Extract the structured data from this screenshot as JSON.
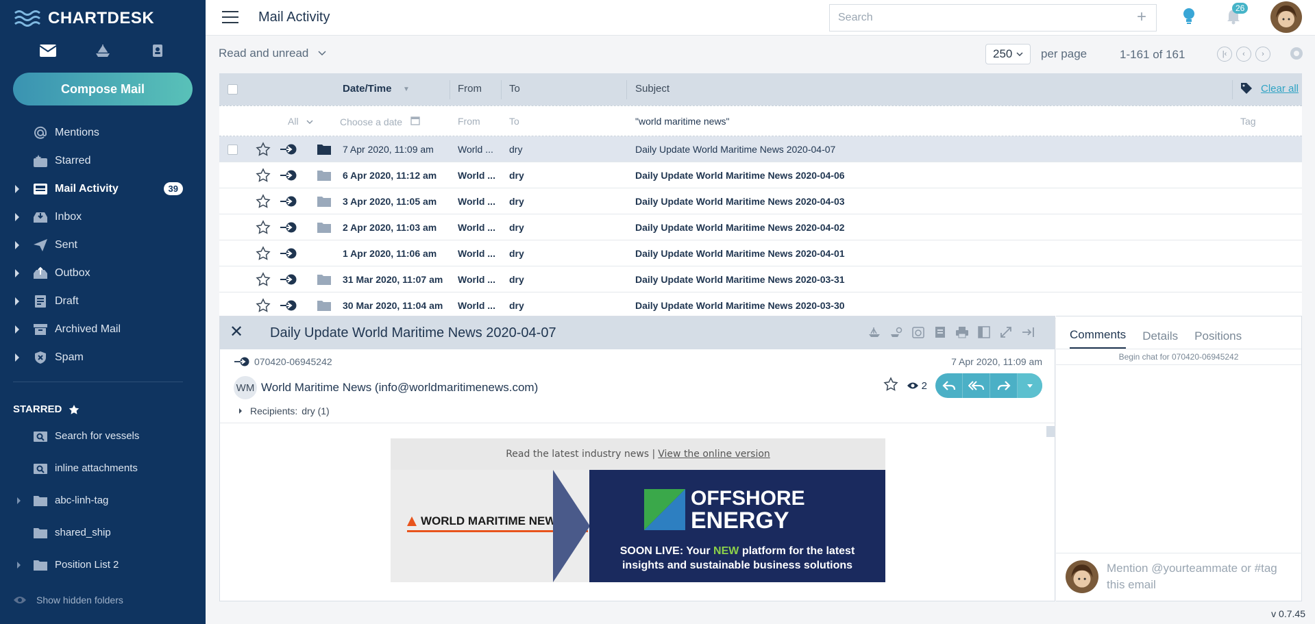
{
  "app": {
    "brand": "CHARTDESK",
    "version": "v 0.7.45"
  },
  "colors": {
    "sidebar": "#0f3460",
    "accent": "#4bb0c6",
    "header_bg": "#d5dde6"
  },
  "sidebar": {
    "compose_label": "Compose Mail",
    "nav": [
      {
        "label": "Mentions",
        "icon": "at-icon"
      },
      {
        "label": "Starred",
        "icon": "starred-inbox-icon"
      },
      {
        "label": "Mail Activity",
        "icon": "mail-activity-icon",
        "badge": "39",
        "active": true
      },
      {
        "label": "Inbox",
        "icon": "inbox-icon"
      },
      {
        "label": "Sent",
        "icon": "sent-icon"
      },
      {
        "label": "Outbox",
        "icon": "outbox-icon"
      },
      {
        "label": "Draft",
        "icon": "draft-icon"
      },
      {
        "label": "Archived Mail",
        "icon": "archive-icon"
      },
      {
        "label": "Spam",
        "icon": "spam-icon"
      }
    ],
    "starred_title": "STARRED",
    "starred_items": [
      {
        "label": "Search for vessels"
      },
      {
        "label": "inline attachments"
      },
      {
        "label": "abc-linh-tag"
      },
      {
        "label": "shared_ship"
      },
      {
        "label": "Position List 2"
      }
    ],
    "show_hidden": "Show hidden folders"
  },
  "topbar": {
    "title": "Mail Activity",
    "search_placeholder": "Search",
    "notifications": "26"
  },
  "toolbar": {
    "read_filter": "Read and unread",
    "per_page_value": "250",
    "per_page_label": "per page",
    "range": "1-161 of 161"
  },
  "table": {
    "headers": {
      "datetime": "Date/Time",
      "from": "From",
      "to": "To",
      "subject": "Subject",
      "clear_all": "Clear all"
    },
    "filters": {
      "all": "All",
      "date": "Choose a date",
      "from": "From",
      "to": "To",
      "subject": "\"world maritime news\"",
      "tag": "Tag"
    },
    "rows": [
      {
        "date": "7 Apr 2020, 11:09 am",
        "from": "World ...",
        "to": "dry",
        "subject": "Daily Update World Maritime News 2020-04-07"
      },
      {
        "date": "6 Apr 2020, 11:12 am",
        "from": "World ...",
        "to": "dry",
        "subject": "Daily Update World Maritime News 2020-04-06"
      },
      {
        "date": "3 Apr 2020, 11:05 am",
        "from": "World ...",
        "to": "dry",
        "subject": "Daily Update World Maritime News 2020-04-03"
      },
      {
        "date": "2 Apr 2020, 11:03 am",
        "from": "World ...",
        "to": "dry",
        "subject": "Daily Update World Maritime News 2020-04-02"
      },
      {
        "date": "1 Apr 2020, 11:06 am",
        "from": "World ...",
        "to": "dry",
        "subject": "Daily Update World Maritime News 2020-04-01"
      },
      {
        "date": "31 Mar 2020, 11:07 am",
        "from": "World ...",
        "to": "dry",
        "subject": "Daily Update World Maritime News 2020-03-31"
      },
      {
        "date": "30 Mar 2020, 11:04 am",
        "from": "World ...",
        "to": "dry",
        "subject": "Daily Update World Maritime News 2020-03-30"
      }
    ]
  },
  "preview": {
    "title": "Daily Update World Maritime News 2020-04-07",
    "mail_id": "070420-06945242",
    "date": "7 Apr 2020, 11:09 am",
    "sender_initials": "WM",
    "sender": "World Maritime News (info@worldmaritimenews.com)",
    "seen_count": "2",
    "recipients_label": "Recipients:",
    "recipients_value": "dry (1)",
    "banner_text": "Read the latest industry news |",
    "banner_link": "View the online version",
    "banner_brand": "WORLD MARITIME NEWS",
    "banner_offshore_1": "OFFSHORE",
    "banner_offshore_2": "ENERGY",
    "banner_soon_a": "SOON LIVE: Your",
    "banner_soon_new": "NEW",
    "banner_soon_b": "platform for the latest",
    "banner_soon_c": "insights and sustainable business solutions"
  },
  "comments": {
    "tabs": [
      "Comments",
      "Details",
      "Positions"
    ],
    "begin_chat": "Begin chat for 070420-06945242",
    "input_placeholder": "Mention @yourteammate or #tag this email"
  }
}
